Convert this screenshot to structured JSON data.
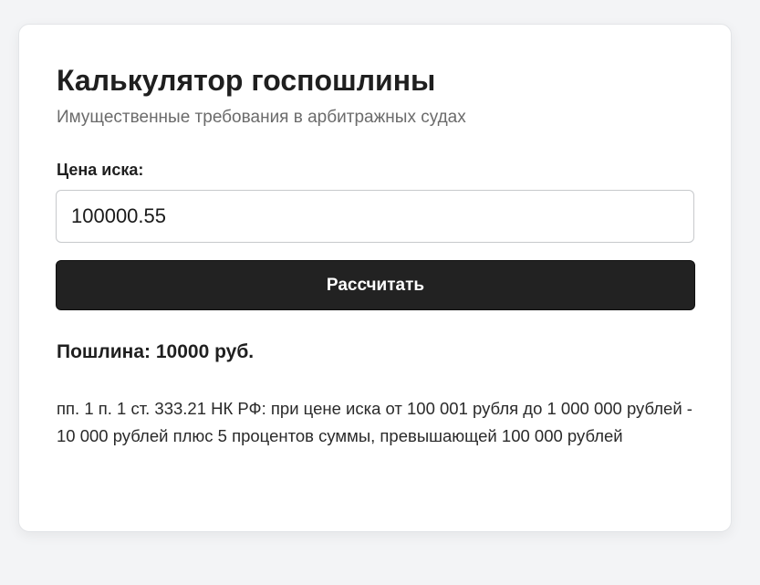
{
  "calculator": {
    "title": "Калькулятор госпошлины",
    "subtitle": "Имущественные требования в арбитражных судах",
    "claim_label": "Цена иска:",
    "claim_value": "100000.55",
    "calculate_label": "Рассчитать",
    "result_text": "Пошлина: 10000 руб.",
    "legal_note": "пп. 1 п. 1 ст. 333.21 НК РФ: при цене иска от 100 001 рубля до 1 000 000 рублей - 10 000 рублей плюс 5 процентов суммы, превышающей 100 000 рублей"
  },
  "colors": {
    "background": "#f3f4f6",
    "card": "#ffffff",
    "button": "#222222",
    "button_text": "#ffffff",
    "subtitle": "#6b6b6b"
  }
}
